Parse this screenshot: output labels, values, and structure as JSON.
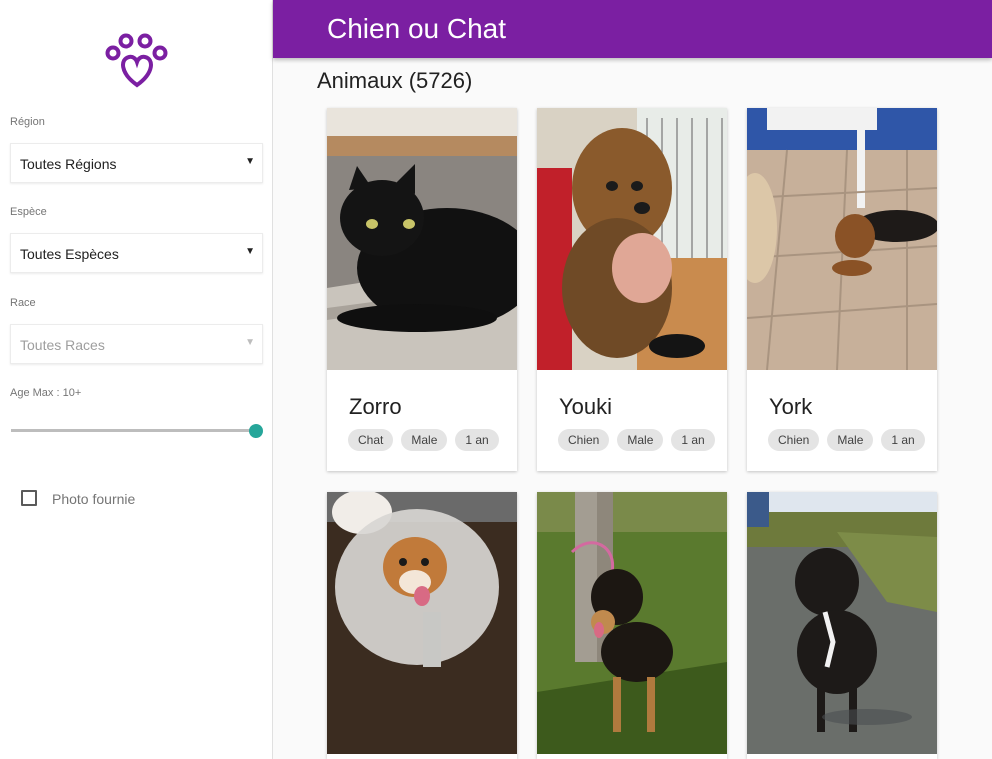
{
  "app": {
    "title": "Chien ou Chat",
    "accent": "#7b1fa2",
    "slider_color": "#26a69a"
  },
  "logo": {
    "icon": "paw-heart-icon"
  },
  "filters": {
    "region": {
      "label": "Région",
      "value": "Toutes Régions"
    },
    "espece": {
      "label": "Espèce",
      "value": "Toutes Espèces"
    },
    "race": {
      "label": "Race",
      "value": "Toutes Races",
      "disabled": true
    },
    "age": {
      "label": "Age Max : 10+",
      "level_fraction": 1.0
    },
    "photo": {
      "label": "Photo fournie",
      "checked": false
    }
  },
  "main": {
    "count_title": "Animaux (5726)"
  },
  "cards": [
    {
      "name": "Zorro",
      "tags": [
        "Chat",
        "Male",
        "1 an"
      ]
    },
    {
      "name": "Youki",
      "tags": [
        "Chien",
        "Male",
        "1 an"
      ]
    },
    {
      "name": "York",
      "tags": [
        "Chien",
        "Male",
        "1 an"
      ]
    },
    {
      "name": "",
      "tags": []
    },
    {
      "name": "",
      "tags": []
    },
    {
      "name": "",
      "tags": []
    }
  ]
}
